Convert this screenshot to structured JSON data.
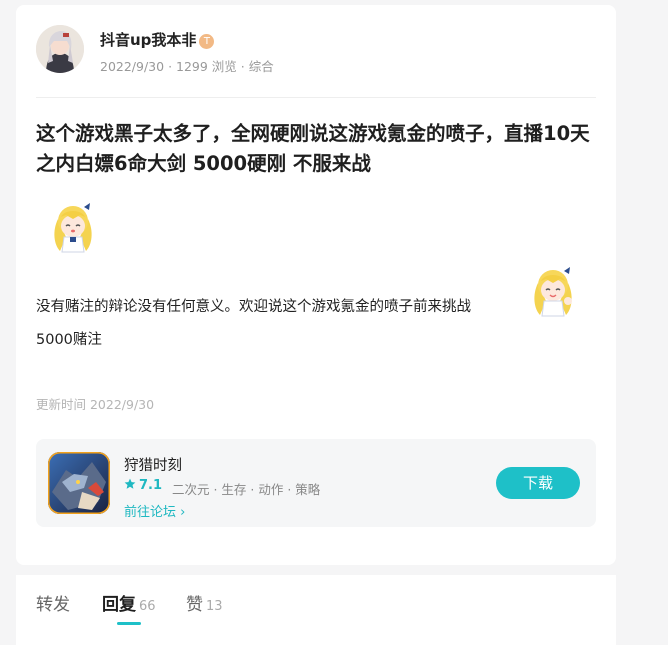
{
  "author": {
    "name": "抖音up我本非",
    "badge": "T",
    "date": "2022/9/30",
    "views": "1299 浏览",
    "category": "综合",
    "meta_sep": " · "
  },
  "post": {
    "title": "这个游戏黑子太多了，全网硬刚说这游戏氪金的喷子，直播10天之内白嫖6命大剑 5000硬刚 不服来战",
    "body_line1": "没有赌注的辩论没有任何意义。欢迎说这个游戏氪金的喷子前来挑战",
    "body_line2": "5000赌注",
    "updated_label": "更新时间 2022/9/30"
  },
  "game": {
    "name": "狩猎时刻",
    "rating": "7.1",
    "tags": "二次元 · 生存 · 动作 · 策略",
    "forum_link": "前往论坛 ›",
    "download_label": "下载"
  },
  "tabs": [
    {
      "label": "转发",
      "count": ""
    },
    {
      "label": "回复",
      "count": "66"
    },
    {
      "label": "赞",
      "count": "13"
    }
  ],
  "colors": {
    "accent": "#1ec0c8",
    "text": "#222222",
    "muted": "#999999"
  }
}
